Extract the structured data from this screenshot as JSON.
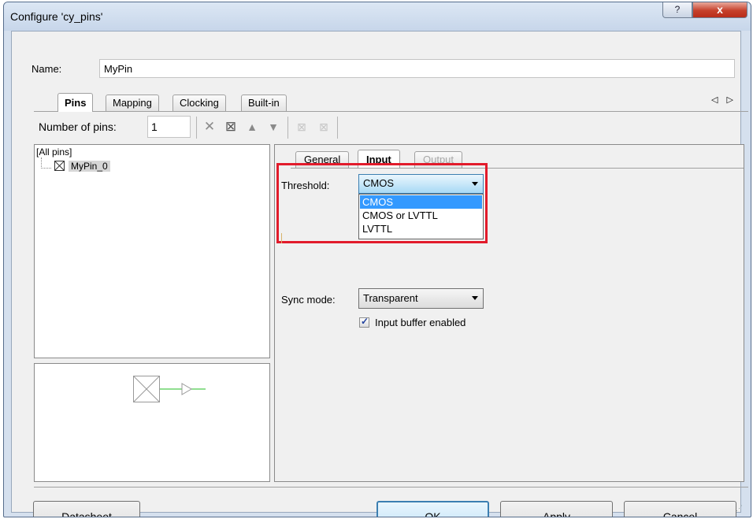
{
  "window": {
    "title": "Configure 'cy_pins'",
    "help_button": "?",
    "close_button": "x"
  },
  "name_field": {
    "label": "Name:",
    "value": "MyPin"
  },
  "tabs": [
    {
      "label": "Pins",
      "active": true
    },
    {
      "label": "Mapping",
      "active": false
    },
    {
      "label": "Clocking",
      "active": false
    },
    {
      "label": "Built-in",
      "active": false
    }
  ],
  "tab_scroll": "◁ ▷",
  "toolbar": {
    "num_pins_label": "Number of pins:",
    "num_pins_value": "1",
    "icons": [
      "delete-icon",
      "pin-select-icon",
      "move-up-icon",
      "move-down-icon",
      "group-icon",
      "ungroup-icon"
    ]
  },
  "pin_tree": {
    "root": "[All pins]",
    "items": [
      "MyPin_0"
    ]
  },
  "subtabs": [
    {
      "label": "General",
      "active": false
    },
    {
      "label": "Input",
      "active": true
    },
    {
      "label": "Output",
      "active": false
    }
  ],
  "input_tab": {
    "threshold_label": "Threshold:",
    "threshold_value": "CMOS",
    "threshold_options": [
      "CMOS",
      "CMOS or LVTTL",
      "LVTTL"
    ],
    "sync_mode_label": "Sync mode:",
    "sync_mode_value": "Transparent",
    "input_buffer_label": "Input buffer enabled",
    "input_buffer_checked": true
  },
  "buttons": {
    "datasheet": "Datasheet",
    "ok": "OK",
    "apply": "Apply",
    "cancel": "Cancel"
  },
  "colors": {
    "highlight_box": "#e21b2b",
    "selected_option": "#3399ff",
    "signal_line": "#4ec94e"
  }
}
